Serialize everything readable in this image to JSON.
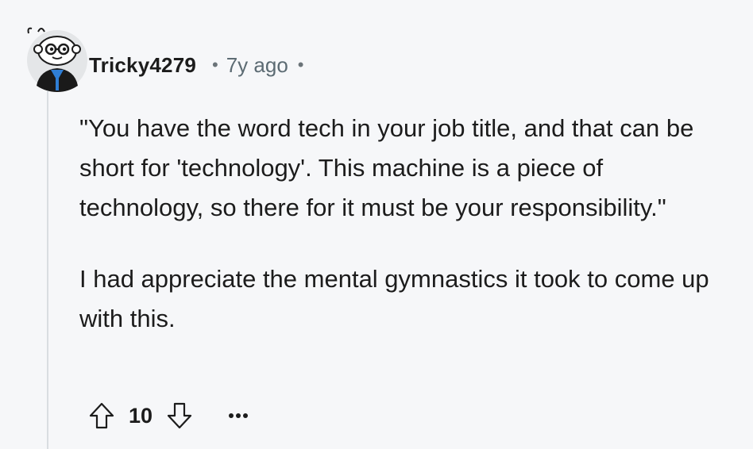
{
  "comment": {
    "username": "Tricky4279",
    "separator": "•",
    "age": "7y ago",
    "body": {
      "paragraph1": "\"You have the word tech in your job title, and that can be short for 'technology'. This machine is a piece of technology, so there for it must be your responsibility.\"",
      "paragraph2": "I had appreciate the mental gymnastics it took to come up with this."
    },
    "actions": {
      "score": "10",
      "upvote_icon": "arrow-up-outline-icon",
      "downvote_icon": "arrow-down-outline-icon",
      "more_icon": "ellipsis-icon"
    }
  },
  "colors": {
    "background": "#f6f7f9",
    "text": "#1c1c1c",
    "meta": "#5c6b73",
    "thread_line": "#d9dde1"
  }
}
